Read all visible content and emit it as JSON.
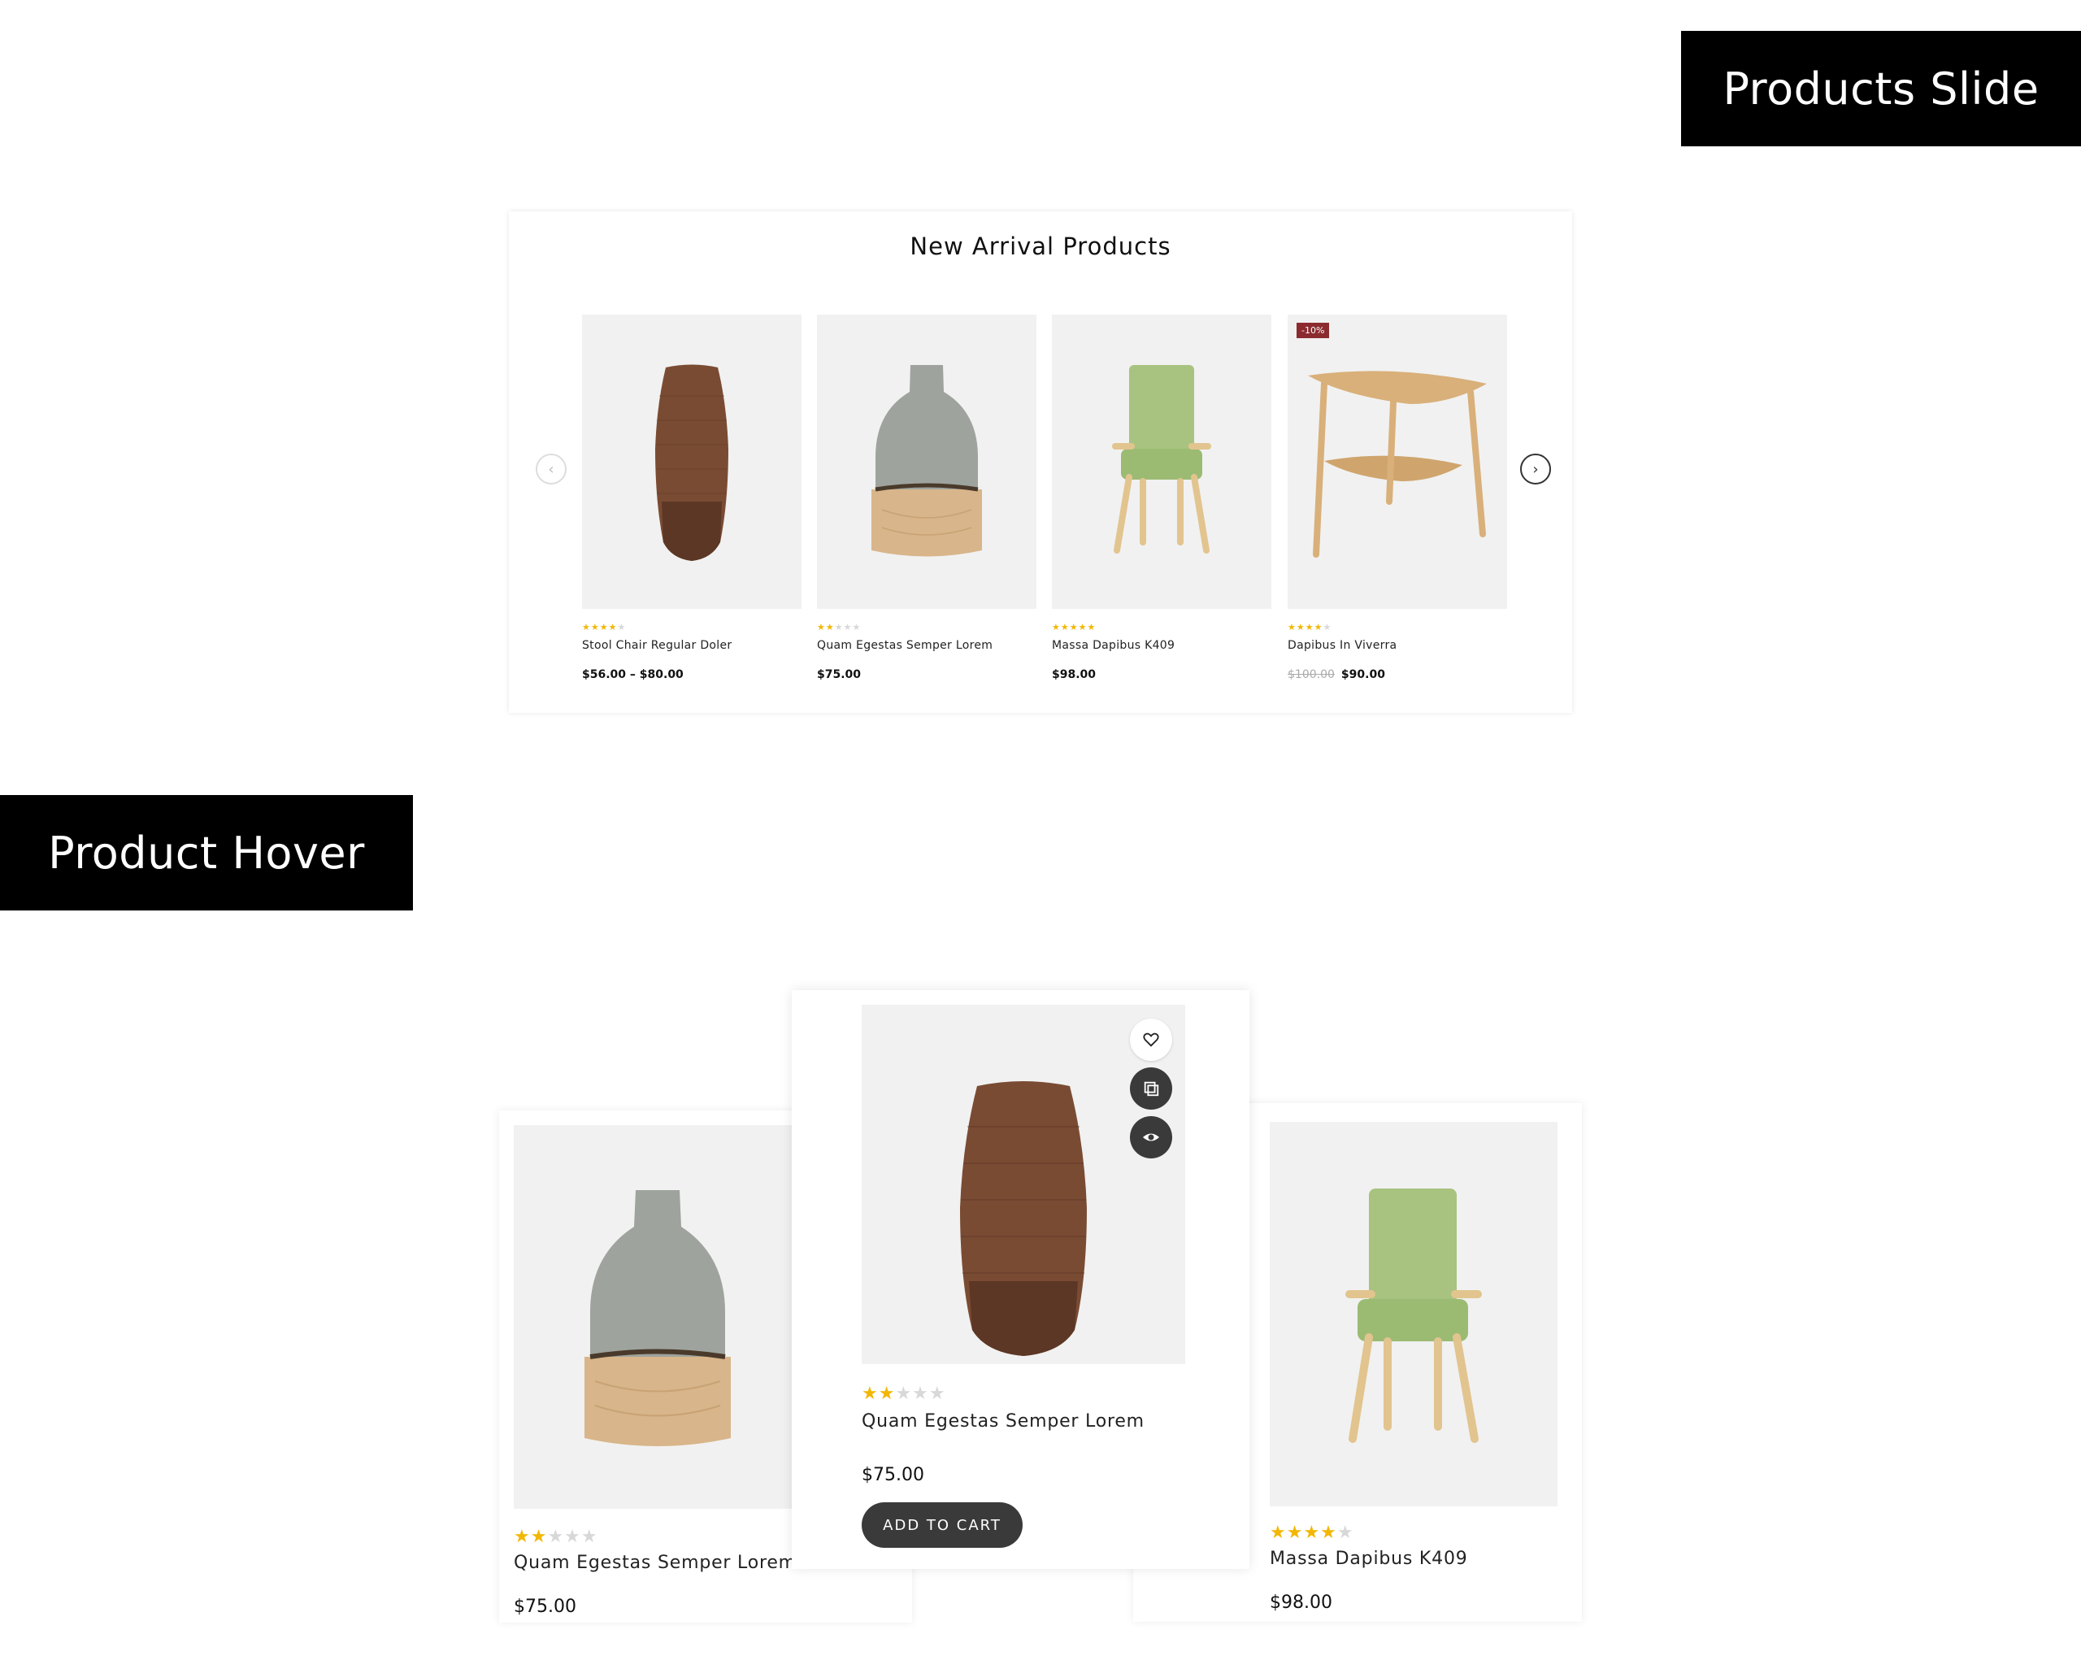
{
  "labels": {
    "products_slide": "Products Slide",
    "product_hover": "Product Hover"
  },
  "slider": {
    "title": "New Arrival Products",
    "prev_icon": "chevron-left-icon",
    "next_icon": "chevron-right-icon",
    "products": [
      {
        "name": "Stool Chair Regular Doler",
        "price": "$56.00 – $80.00",
        "old_price": "",
        "badge": "",
        "rating": 3.5,
        "image": "rope-vase"
      },
      {
        "name": "Quam Egestas Semper Lorem",
        "price": "$75.00",
        "old_price": "",
        "badge": "",
        "rating": 2.5,
        "image": "glass-vase"
      },
      {
        "name": "Massa Dapibus K409",
        "price": "$98.00",
        "old_price": "",
        "badge": "",
        "rating": 5,
        "image": "green-chair"
      },
      {
        "name": "Dapibus In Viverra",
        "price": "$90.00",
        "old_price": "$100.00",
        "badge": "-10%",
        "rating": 3.5,
        "image": "side-table"
      }
    ]
  },
  "hover": {
    "left": {
      "name": "Quam Egestas Semper Lorem",
      "price": "$75.00",
      "rating": 2.5,
      "image": "glass-vase"
    },
    "center": {
      "name": "Quam Egestas Semper Lorem",
      "price": "$75.00",
      "rating": 2.5,
      "image": "rope-vase",
      "add_to_cart": "ADD TO CART",
      "actions": [
        "heart-icon",
        "compare-icon",
        "eye-icon"
      ]
    },
    "right": {
      "name": "Massa Dapibus K409",
      "price": "$98.00",
      "rating": 4.5,
      "image": "green-chair"
    }
  },
  "colors": {
    "star": "#f2b704",
    "badge": "#8b2b2f",
    "button": "#3a3a3a",
    "image_bg": "#f1f1f1"
  }
}
